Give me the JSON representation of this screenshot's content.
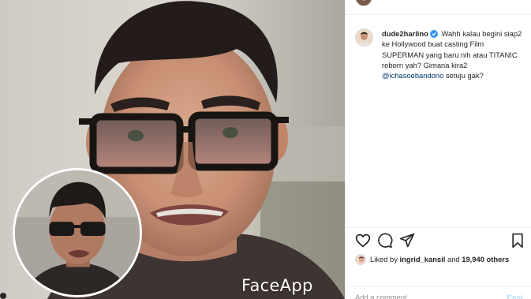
{
  "media": {
    "watermark": "FaceApp"
  },
  "comment": {
    "username": "dude2harlino",
    "text_before_mention": " Wahh kalau begini siap2 ke Hollywood buat casting Film SUPERMAN yang baru nih atau TITANIC reborn yah? Gimana kira2 ",
    "mention": "@ichasoebandono",
    "text_after_mention": " setuju gak?"
  },
  "actions": {
    "like_icon": "heart-icon",
    "comment_icon": "comment-icon",
    "share_icon": "paper-plane-icon",
    "save_icon": "bookmark-icon"
  },
  "likes": {
    "prefix": "Liked by ",
    "user": "ingrid_kansil",
    "middle": " and ",
    "count_text": "19,940 others"
  },
  "add_comment": {
    "placeholder": "Add a comment…",
    "post_label": "Post"
  },
  "colors": {
    "text": "#262626",
    "mention": "#00376b",
    "verified": "#3897f0",
    "muted": "#8e8e8e",
    "post_disabled": "#b2dffc"
  }
}
